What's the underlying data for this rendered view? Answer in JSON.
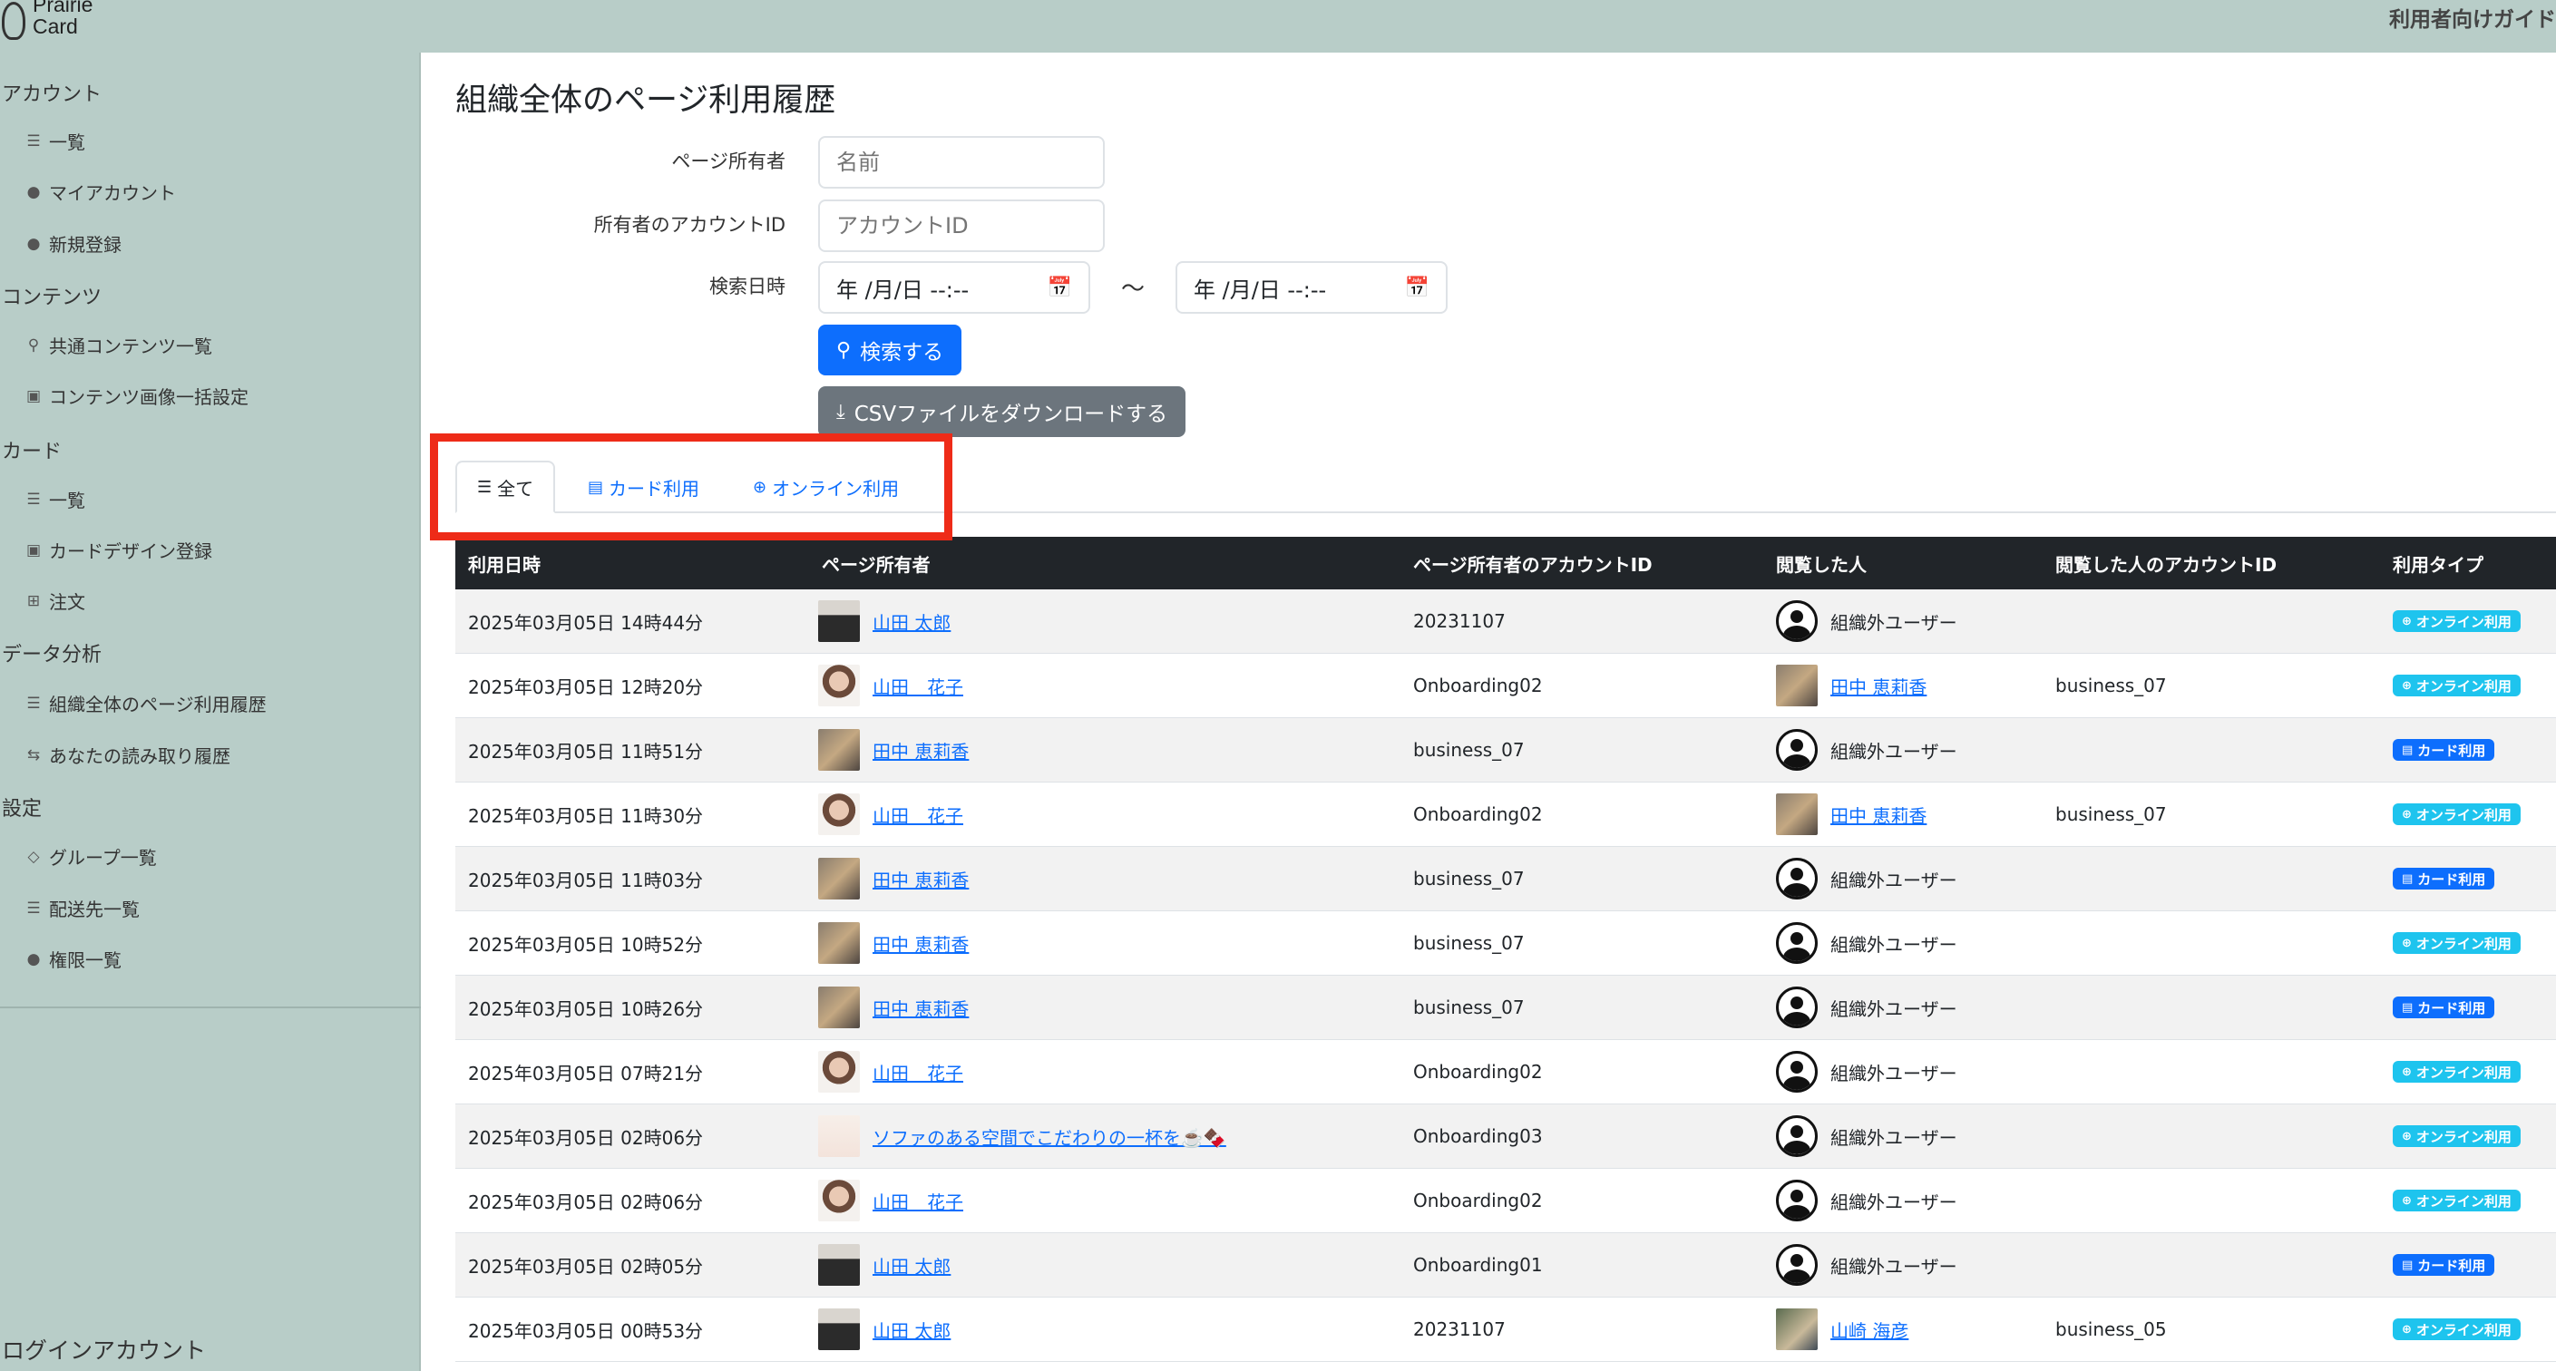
{
  "app": {
    "logo_line1": "Prairie",
    "logo_line2": "Card",
    "guide_link": "利用者向けガイド"
  },
  "sidebar": {
    "sections": [
      {
        "title": "アカウント",
        "items": [
          {
            "label": "一覧",
            "icon": "list-icon"
          },
          {
            "label": "マイアカウント",
            "icon": "person-icon"
          },
          {
            "label": "新規登録",
            "icon": "person-add-icon"
          }
        ]
      },
      {
        "title": "コンテンツ",
        "items": [
          {
            "label": "共通コンテンツ一覧",
            "icon": "link-icon"
          },
          {
            "label": "コンテンツ画像一括設定",
            "icon": "image-icon"
          }
        ]
      },
      {
        "title": "カード",
        "items": [
          {
            "label": "一覧",
            "icon": "list-icon"
          },
          {
            "label": "カードデザイン登録",
            "icon": "image-icon"
          },
          {
            "label": "注文",
            "icon": "cart-icon"
          }
        ]
      },
      {
        "title": "データ分析",
        "items": [
          {
            "label": "組織全体のページ利用履歴",
            "icon": "list-icon"
          },
          {
            "label": "あなたの読み取り履歴",
            "icon": "arrows-icon"
          }
        ]
      },
      {
        "title": "設定",
        "items": [
          {
            "label": "グループ一覧",
            "icon": "tag-icon"
          },
          {
            "label": "配送先一覧",
            "icon": "list-icon"
          },
          {
            "label": "権限一覧",
            "icon": "person-lock-icon"
          }
        ]
      }
    ],
    "login_account": "ログインアカウント"
  },
  "main": {
    "title": "組織全体のページ利用履歴",
    "form": {
      "owner_label": "ページ所有者",
      "owner_placeholder": "名前",
      "account_label": "所有者のアカウントID",
      "account_placeholder": "アカウントID",
      "date_label": "検索日時",
      "date_from": "年 /月/日 --:--",
      "date_to": "年 /月/日 --:--",
      "tilde": "〜",
      "search_button": "検索する",
      "csv_button": "CSVファイルをダウンロードする"
    },
    "tabs": [
      {
        "label": "全て",
        "icon": "list-icon",
        "active": true
      },
      {
        "label": "カード利用",
        "icon": "card-icon",
        "active": false
      },
      {
        "label": "オンライン利用",
        "icon": "globe-icon",
        "active": false
      }
    ],
    "highlight_color": "#ee2b18",
    "table": {
      "headers": [
        "利用日時",
        "ページ所有者",
        "ページ所有者のアカウントID",
        "閲覧した人",
        "閲覧した人のアカウントID",
        "利用タイプ"
      ],
      "rows": [
        {
          "date": "2025年03月05日 14時44分",
          "owner": "山田 太郎",
          "owner_avatar": "man",
          "account": "20231107",
          "viewer": "組織外ユーザー",
          "viewer_link": false,
          "viewer_avatar": "anon",
          "viewer_account": "",
          "type": "オンライン利用",
          "type_kind": "online"
        },
        {
          "date": "2025年03月05日 12時20分",
          "owner": "山田　花子",
          "owner_avatar": "woman",
          "account": "Onboarding02",
          "viewer": "田中 恵莉香",
          "viewer_link": true,
          "viewer_avatar": "tanaka",
          "viewer_account": "business_07",
          "type": "オンライン利用",
          "type_kind": "online"
        },
        {
          "date": "2025年03月05日 11時51分",
          "owner": "田中 恵莉香",
          "owner_avatar": "tanaka",
          "account": "business_07",
          "viewer": "組織外ユーザー",
          "viewer_link": false,
          "viewer_avatar": "anon",
          "viewer_account": "",
          "type": "カード利用",
          "type_kind": "card"
        },
        {
          "date": "2025年03月05日 11時30分",
          "owner": "山田　花子",
          "owner_avatar": "woman",
          "account": "Onboarding02",
          "viewer": "田中 恵莉香",
          "viewer_link": true,
          "viewer_avatar": "tanaka",
          "viewer_account": "business_07",
          "type": "オンライン利用",
          "type_kind": "online"
        },
        {
          "date": "2025年03月05日 11時03分",
          "owner": "田中 恵莉香",
          "owner_avatar": "tanaka",
          "account": "business_07",
          "viewer": "組織外ユーザー",
          "viewer_link": false,
          "viewer_avatar": "anon",
          "viewer_account": "",
          "type": "カード利用",
          "type_kind": "card"
        },
        {
          "date": "2025年03月05日 10時52分",
          "owner": "田中 恵莉香",
          "owner_avatar": "tanaka",
          "account": "business_07",
          "viewer": "組織外ユーザー",
          "viewer_link": false,
          "viewer_avatar": "anon",
          "viewer_account": "",
          "type": "オンライン利用",
          "type_kind": "online"
        },
        {
          "date": "2025年03月05日 10時26分",
          "owner": "田中 恵莉香",
          "owner_avatar": "tanaka",
          "account": "business_07",
          "viewer": "組織外ユーザー",
          "viewer_link": false,
          "viewer_avatar": "anon",
          "viewer_account": "",
          "type": "カード利用",
          "type_kind": "card"
        },
        {
          "date": "2025年03月05日 07時21分",
          "owner": "山田　花子",
          "owner_avatar": "woman",
          "account": "Onboarding02",
          "viewer": "組織外ユーザー",
          "viewer_link": false,
          "viewer_avatar": "anon",
          "viewer_account": "",
          "type": "オンライン利用",
          "type_kind": "online"
        },
        {
          "date": "2025年03月05日 02時06分",
          "owner": "ソファのある空間でこだわりの一杯を☕️🍫",
          "owner_avatar": "sofa",
          "account": "Onboarding03",
          "viewer": "組織外ユーザー",
          "viewer_link": false,
          "viewer_avatar": "anon",
          "viewer_account": "",
          "type": "オンライン利用",
          "type_kind": "online"
        },
        {
          "date": "2025年03月05日 02時06分",
          "owner": "山田　花子",
          "owner_avatar": "woman",
          "account": "Onboarding02",
          "viewer": "組織外ユーザー",
          "viewer_link": false,
          "viewer_avatar": "anon",
          "viewer_account": "",
          "type": "オンライン利用",
          "type_kind": "online"
        },
        {
          "date": "2025年03月05日 02時05分",
          "owner": "山田 太郎",
          "owner_avatar": "man",
          "account": "Onboarding01",
          "viewer": "組織外ユーザー",
          "viewer_link": false,
          "viewer_avatar": "anon",
          "viewer_account": "",
          "type": "カード利用",
          "type_kind": "card"
        },
        {
          "date": "2025年03月05日 00時53分",
          "owner": "山田 太郎",
          "owner_avatar": "man",
          "account": "20231107",
          "viewer": "山崎 海彦",
          "viewer_link": true,
          "viewer_avatar": "yama",
          "viewer_account": "business_05",
          "type": "オンライン利用",
          "type_kind": "online"
        }
      ]
    }
  }
}
